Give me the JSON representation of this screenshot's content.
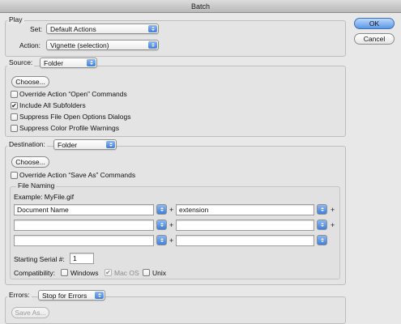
{
  "window": {
    "title": "Batch"
  },
  "buttons": {
    "ok": "OK",
    "cancel": "Cancel"
  },
  "play": {
    "label": "Play",
    "set_label": "Set:",
    "set_value": "Default Actions",
    "action_label": "Action:",
    "action_value": "Vignette (selection)"
  },
  "source": {
    "label": "Source:",
    "value": "Folder",
    "choose": "Choose...",
    "options": [
      {
        "label": "Override Action “Open” Commands",
        "checked": false
      },
      {
        "label": "Include All Subfolders",
        "checked": true
      },
      {
        "label": "Suppress File Open Options Dialogs",
        "checked": false
      },
      {
        "label": "Suppress Color Profile Warnings",
        "checked": false
      }
    ]
  },
  "destination": {
    "label": "Destination:",
    "value": "Folder",
    "choose": "Choose...",
    "override_label": "Override Action “Save As” Commands",
    "override_checked": false
  },
  "file_naming": {
    "label": "File Naming",
    "example": "Example: MyFile.gif",
    "rows": [
      [
        "Document Name",
        "extension"
      ],
      [
        "",
        ""
      ],
      [
        "",
        ""
      ]
    ],
    "plus": "+",
    "serial_label": "Starting Serial #:",
    "serial_value": "1",
    "compat_label": "Compatibility:",
    "compat": [
      {
        "label": "Windows",
        "checked": false,
        "disabled": false
      },
      {
        "label": "Mac OS",
        "checked": true,
        "disabled": true
      },
      {
        "label": "Unix",
        "checked": false,
        "disabled": false
      }
    ]
  },
  "errors": {
    "label": "Errors:",
    "value": "Stop for Errors",
    "save_as": "Save As..."
  },
  "check_glyph": "✔"
}
